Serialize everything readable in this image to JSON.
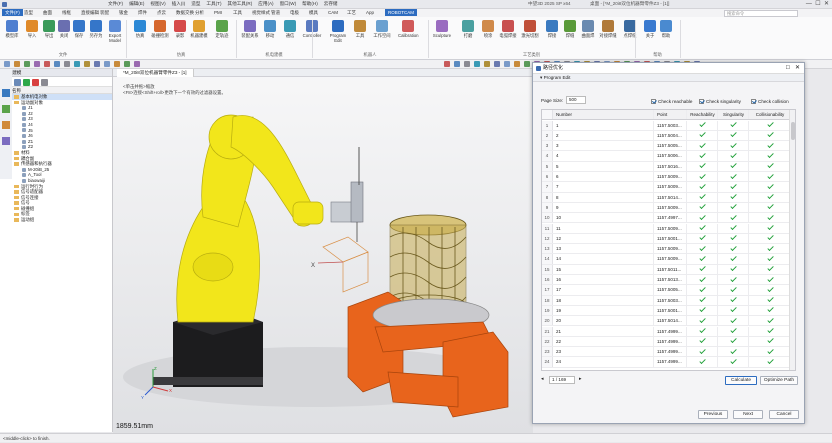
{
  "titlebar": {
    "app_title": "中望3D 2025 SP x64",
    "doc_title": "桌面 - [*M_20i8双位机器臂零件Z3 - [1]]",
    "search_placeholder": "搜索命令"
  },
  "menu": [
    "文件(F)",
    "编辑(E)",
    "视图(V)",
    "插入(I)",
    "造型",
    "工具(T)",
    "其他工具(R)",
    "应用(A)",
    "窗口(W)",
    "帮助(H)",
    "云存储"
  ],
  "ribbon_tabs": [
    {
      "label": "文件(F)",
      "active": true
    },
    {
      "label": "造型"
    },
    {
      "label": "曲面"
    },
    {
      "label": "线框"
    },
    {
      "label": "直接编辑"
    },
    {
      "label": "装配"
    },
    {
      "label": "钣金"
    },
    {
      "label": "焊件"
    },
    {
      "label": "点云"
    },
    {
      "label": "数据交换"
    },
    {
      "label": "分析"
    },
    {
      "label": "PMI"
    },
    {
      "label": "工具"
    },
    {
      "label": "视觉样式"
    },
    {
      "label": "管道"
    },
    {
      "label": "电极"
    },
    {
      "label": "模具"
    },
    {
      "label": "CAM"
    },
    {
      "label": "工艺"
    },
    {
      "label": "App"
    },
    {
      "label": "ROBOTCAM",
      "active": true
    }
  ],
  "ribbon_tools": [
    {
      "label": "模型库",
      "color": "#4f7fd0"
    },
    {
      "label": "导入",
      "color": "#e08a2a"
    },
    {
      "label": "导出",
      "color": "#3a9a5a"
    },
    {
      "label": "关闭",
      "color": "#6a6fb0"
    },
    {
      "label": "保存",
      "color": "#3576c9"
    },
    {
      "label": "另存为",
      "color": "#3576c9"
    },
    {
      "label": "Export Model",
      "color": "#5a8ad6"
    },
    {
      "label": "仿真",
      "color": "#2d89d6"
    },
    {
      "label": "碰撞检测",
      "color": "#d6672d"
    },
    {
      "label": "录影",
      "color": "#d64a4a"
    },
    {
      "label": "机器建模",
      "color": "#e0a030"
    },
    {
      "label": "定轨迹",
      "color": "#5aa34a"
    },
    {
      "label": "装配关系",
      "color": "#7b6cc0"
    },
    {
      "label": "移动",
      "color": "#4a90c8"
    },
    {
      "label": "通信",
      "color": "#3a9ab5"
    },
    {
      "label": "Controller",
      "color": "#5a7ac0"
    },
    {
      "label": "Program Edit",
      "color": "#2d6cc0"
    },
    {
      "label": "工具",
      "color": "#c08a3a"
    },
    {
      "label": "工作空间",
      "color": "#6aa0d0"
    },
    {
      "label": "Calibration",
      "color": "#d05a5a"
    },
    {
      "label": "Sculpture",
      "color": "#9a6cc0"
    },
    {
      "label": "打磨",
      "color": "#4aa0a0"
    },
    {
      "label": "喷涂",
      "color": "#d08a4a"
    },
    {
      "label": "电弧焊接",
      "color": "#c85050"
    },
    {
      "label": "激光切割",
      "color": "#c0503a"
    },
    {
      "label": "焊接",
      "color": "#3a7ac0"
    },
    {
      "label": "焊缝",
      "color": "#5a9a3a"
    },
    {
      "label": "曲面焊",
      "color": "#6a8ab0"
    },
    {
      "label": "对接焊缝",
      "color": "#b07a3a"
    },
    {
      "label": "点焊缝",
      "color": "#3a6aa0"
    },
    {
      "label": "关于",
      "color": "#3a7ad0"
    },
    {
      "label": "帮助",
      "color": "#4a8ad0"
    }
  ],
  "ribbon_groups": [
    "文件",
    "仿真",
    "机电建模",
    "机器人",
    "工艺类别",
    "帮助"
  ],
  "left_panel": {
    "title": "机电建模",
    "column_header": "名称",
    "tree": [
      {
        "label": "基本机电对象",
        "level": 0,
        "type": "folder",
        "selected": true
      },
      {
        "label": "运动副对象",
        "level": 0,
        "type": "folder"
      },
      {
        "label": "J1",
        "level": 1,
        "type": "joint"
      },
      {
        "label": "J2",
        "level": 1,
        "type": "joint"
      },
      {
        "label": "J3",
        "level": 1,
        "type": "joint"
      },
      {
        "label": "J4",
        "level": 1,
        "type": "joint"
      },
      {
        "label": "J5",
        "level": 1,
        "type": "joint"
      },
      {
        "label": "J6",
        "level": 1,
        "type": "joint"
      },
      {
        "label": "Z1",
        "level": 1,
        "type": "joint"
      },
      {
        "label": "Z2",
        "level": 1,
        "type": "joint"
      },
      {
        "label": "材料",
        "level": 0,
        "type": "folder"
      },
      {
        "label": "耦合副",
        "level": 0,
        "type": "folder"
      },
      {
        "label": "传感器和执行器",
        "level": 0,
        "type": "folder"
      },
      {
        "label": "M-20iB_25",
        "level": 1,
        "type": "joint"
      },
      {
        "label": "A_Tool",
        "level": 1,
        "type": "joint"
      },
      {
        "label": "biaowaiji",
        "level": 1,
        "type": "joint"
      },
      {
        "label": "运行时行为",
        "level": 0,
        "type": "folder"
      },
      {
        "label": "信号适配器",
        "level": 0,
        "type": "folder"
      },
      {
        "label": "信号连接",
        "level": 0,
        "type": "folder"
      },
      {
        "label": "信号",
        "level": 0,
        "type": "folder"
      },
      {
        "label": "碰撞组",
        "level": 0,
        "type": "folder"
      },
      {
        "label": "标签",
        "level": 0,
        "type": "folder"
      },
      {
        "label": "运动组",
        "level": 0,
        "type": "folder"
      }
    ]
  },
  "viewport": {
    "tab": "*M_20i8双位机器臂零件Z3 - [1]",
    "hint_line1": "<单击并拖>缩放",
    "hint_line2": "<F8>连接<Shift+roll>更改下一个有效的过滤器设置。",
    "readout": "1859.51mm",
    "axis_x": "X",
    "axis_y": "Y",
    "axis_z": "Z"
  },
  "dialog": {
    "title": "路径优化",
    "section": "Program Edit",
    "page_size_label": "Page Size:",
    "page_size_value": "500",
    "checks": [
      "Check reachable",
      "Check singularity",
      "Check collision"
    ],
    "columns": [
      "Number",
      "Point",
      "Reachability",
      "Singularity",
      "Collisionability"
    ],
    "rows": [
      {
        "n": "1",
        "num": "1",
        "pt": "1157.5003..."
      },
      {
        "n": "2",
        "num": "2",
        "pt": "1157.5004..."
      },
      {
        "n": "3",
        "num": "3",
        "pt": "1157.5005..."
      },
      {
        "n": "4",
        "num": "4",
        "pt": "1157.5006..."
      },
      {
        "n": "5",
        "num": "5",
        "pt": "1157.5016..."
      },
      {
        "n": "6",
        "num": "6",
        "pt": "1157.5009..."
      },
      {
        "n": "7",
        "num": "7",
        "pt": "1157.5009..."
      },
      {
        "n": "8",
        "num": "8",
        "pt": "1157.5014..."
      },
      {
        "n": "9",
        "num": "9",
        "pt": "1157.5009..."
      },
      {
        "n": "10",
        "num": "10",
        "pt": "1157.4997..."
      },
      {
        "n": "11",
        "num": "11",
        "pt": "1157.5009..."
      },
      {
        "n": "12",
        "num": "12",
        "pt": "1157.5001..."
      },
      {
        "n": "13",
        "num": "13",
        "pt": "1157.5009..."
      },
      {
        "n": "14",
        "num": "14",
        "pt": "1157.5009..."
      },
      {
        "n": "15",
        "num": "15",
        "pt": "1157.5011..."
      },
      {
        "n": "16",
        "num": "16",
        "pt": "1157.5013..."
      },
      {
        "n": "17",
        "num": "17",
        "pt": "1157.5005..."
      },
      {
        "n": "18",
        "num": "18",
        "pt": "1157.5003..."
      },
      {
        "n": "19",
        "num": "19",
        "pt": "1157.5001..."
      },
      {
        "n": "20",
        "num": "20",
        "pt": "1157.5014..."
      },
      {
        "n": "21",
        "num": "21",
        "pt": "1157.4999..."
      },
      {
        "n": "22",
        "num": "22",
        "pt": "1157.4999..."
      },
      {
        "n": "23",
        "num": "23",
        "pt": "1157.4999..."
      },
      {
        "n": "24",
        "num": "24",
        "pt": "1157.4999..."
      }
    ],
    "pager": "1 / 169",
    "calculate": "Calculate",
    "optimize": "Optimize Path",
    "previous": "Previous",
    "next": "Next",
    "cancel": "Cancel"
  },
  "status": "<middle-click> to finish."
}
